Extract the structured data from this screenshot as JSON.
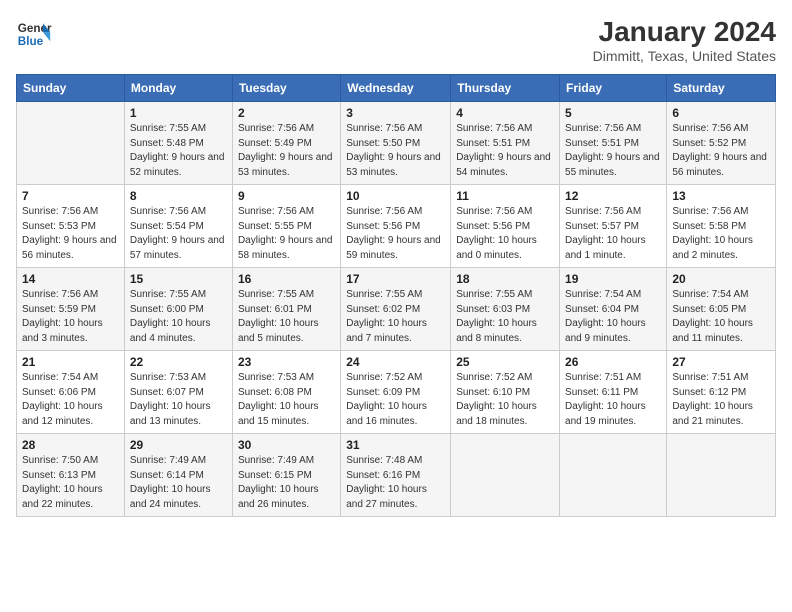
{
  "header": {
    "logo_line1": "General",
    "logo_line2": "Blue",
    "month": "January 2024",
    "location": "Dimmitt, Texas, United States"
  },
  "columns": [
    "Sunday",
    "Monday",
    "Tuesday",
    "Wednesday",
    "Thursday",
    "Friday",
    "Saturday"
  ],
  "weeks": [
    [
      {
        "day": "",
        "sunrise": "",
        "sunset": "",
        "daylight": ""
      },
      {
        "day": "1",
        "sunrise": "Sunrise: 7:55 AM",
        "sunset": "Sunset: 5:48 PM",
        "daylight": "Daylight: 9 hours and 52 minutes."
      },
      {
        "day": "2",
        "sunrise": "Sunrise: 7:56 AM",
        "sunset": "Sunset: 5:49 PM",
        "daylight": "Daylight: 9 hours and 53 minutes."
      },
      {
        "day": "3",
        "sunrise": "Sunrise: 7:56 AM",
        "sunset": "Sunset: 5:50 PM",
        "daylight": "Daylight: 9 hours and 53 minutes."
      },
      {
        "day": "4",
        "sunrise": "Sunrise: 7:56 AM",
        "sunset": "Sunset: 5:51 PM",
        "daylight": "Daylight: 9 hours and 54 minutes."
      },
      {
        "day": "5",
        "sunrise": "Sunrise: 7:56 AM",
        "sunset": "Sunset: 5:51 PM",
        "daylight": "Daylight: 9 hours and 55 minutes."
      },
      {
        "day": "6",
        "sunrise": "Sunrise: 7:56 AM",
        "sunset": "Sunset: 5:52 PM",
        "daylight": "Daylight: 9 hours and 56 minutes."
      }
    ],
    [
      {
        "day": "7",
        "sunrise": "Sunrise: 7:56 AM",
        "sunset": "Sunset: 5:53 PM",
        "daylight": "Daylight: 9 hours and 56 minutes."
      },
      {
        "day": "8",
        "sunrise": "Sunrise: 7:56 AM",
        "sunset": "Sunset: 5:54 PM",
        "daylight": "Daylight: 9 hours and 57 minutes."
      },
      {
        "day": "9",
        "sunrise": "Sunrise: 7:56 AM",
        "sunset": "Sunset: 5:55 PM",
        "daylight": "Daylight: 9 hours and 58 minutes."
      },
      {
        "day": "10",
        "sunrise": "Sunrise: 7:56 AM",
        "sunset": "Sunset: 5:56 PM",
        "daylight": "Daylight: 9 hours and 59 minutes."
      },
      {
        "day": "11",
        "sunrise": "Sunrise: 7:56 AM",
        "sunset": "Sunset: 5:56 PM",
        "daylight": "Daylight: 10 hours and 0 minutes."
      },
      {
        "day": "12",
        "sunrise": "Sunrise: 7:56 AM",
        "sunset": "Sunset: 5:57 PM",
        "daylight": "Daylight: 10 hours and 1 minute."
      },
      {
        "day": "13",
        "sunrise": "Sunrise: 7:56 AM",
        "sunset": "Sunset: 5:58 PM",
        "daylight": "Daylight: 10 hours and 2 minutes."
      }
    ],
    [
      {
        "day": "14",
        "sunrise": "Sunrise: 7:56 AM",
        "sunset": "Sunset: 5:59 PM",
        "daylight": "Daylight: 10 hours and 3 minutes."
      },
      {
        "day": "15",
        "sunrise": "Sunrise: 7:55 AM",
        "sunset": "Sunset: 6:00 PM",
        "daylight": "Daylight: 10 hours and 4 minutes."
      },
      {
        "day": "16",
        "sunrise": "Sunrise: 7:55 AM",
        "sunset": "Sunset: 6:01 PM",
        "daylight": "Daylight: 10 hours and 5 minutes."
      },
      {
        "day": "17",
        "sunrise": "Sunrise: 7:55 AM",
        "sunset": "Sunset: 6:02 PM",
        "daylight": "Daylight: 10 hours and 7 minutes."
      },
      {
        "day": "18",
        "sunrise": "Sunrise: 7:55 AM",
        "sunset": "Sunset: 6:03 PM",
        "daylight": "Daylight: 10 hours and 8 minutes."
      },
      {
        "day": "19",
        "sunrise": "Sunrise: 7:54 AM",
        "sunset": "Sunset: 6:04 PM",
        "daylight": "Daylight: 10 hours and 9 minutes."
      },
      {
        "day": "20",
        "sunrise": "Sunrise: 7:54 AM",
        "sunset": "Sunset: 6:05 PM",
        "daylight": "Daylight: 10 hours and 11 minutes."
      }
    ],
    [
      {
        "day": "21",
        "sunrise": "Sunrise: 7:54 AM",
        "sunset": "Sunset: 6:06 PM",
        "daylight": "Daylight: 10 hours and 12 minutes."
      },
      {
        "day": "22",
        "sunrise": "Sunrise: 7:53 AM",
        "sunset": "Sunset: 6:07 PM",
        "daylight": "Daylight: 10 hours and 13 minutes."
      },
      {
        "day": "23",
        "sunrise": "Sunrise: 7:53 AM",
        "sunset": "Sunset: 6:08 PM",
        "daylight": "Daylight: 10 hours and 15 minutes."
      },
      {
        "day": "24",
        "sunrise": "Sunrise: 7:52 AM",
        "sunset": "Sunset: 6:09 PM",
        "daylight": "Daylight: 10 hours and 16 minutes."
      },
      {
        "day": "25",
        "sunrise": "Sunrise: 7:52 AM",
        "sunset": "Sunset: 6:10 PM",
        "daylight": "Daylight: 10 hours and 18 minutes."
      },
      {
        "day": "26",
        "sunrise": "Sunrise: 7:51 AM",
        "sunset": "Sunset: 6:11 PM",
        "daylight": "Daylight: 10 hours and 19 minutes."
      },
      {
        "day": "27",
        "sunrise": "Sunrise: 7:51 AM",
        "sunset": "Sunset: 6:12 PM",
        "daylight": "Daylight: 10 hours and 21 minutes."
      }
    ],
    [
      {
        "day": "28",
        "sunrise": "Sunrise: 7:50 AM",
        "sunset": "Sunset: 6:13 PM",
        "daylight": "Daylight: 10 hours and 22 minutes."
      },
      {
        "day": "29",
        "sunrise": "Sunrise: 7:49 AM",
        "sunset": "Sunset: 6:14 PM",
        "daylight": "Daylight: 10 hours and 24 minutes."
      },
      {
        "day": "30",
        "sunrise": "Sunrise: 7:49 AM",
        "sunset": "Sunset: 6:15 PM",
        "daylight": "Daylight: 10 hours and 26 minutes."
      },
      {
        "day": "31",
        "sunrise": "Sunrise: 7:48 AM",
        "sunset": "Sunset: 6:16 PM",
        "daylight": "Daylight: 10 hours and 27 minutes."
      },
      {
        "day": "",
        "sunrise": "",
        "sunset": "",
        "daylight": ""
      },
      {
        "day": "",
        "sunrise": "",
        "sunset": "",
        "daylight": ""
      },
      {
        "day": "",
        "sunrise": "",
        "sunset": "",
        "daylight": ""
      }
    ]
  ]
}
